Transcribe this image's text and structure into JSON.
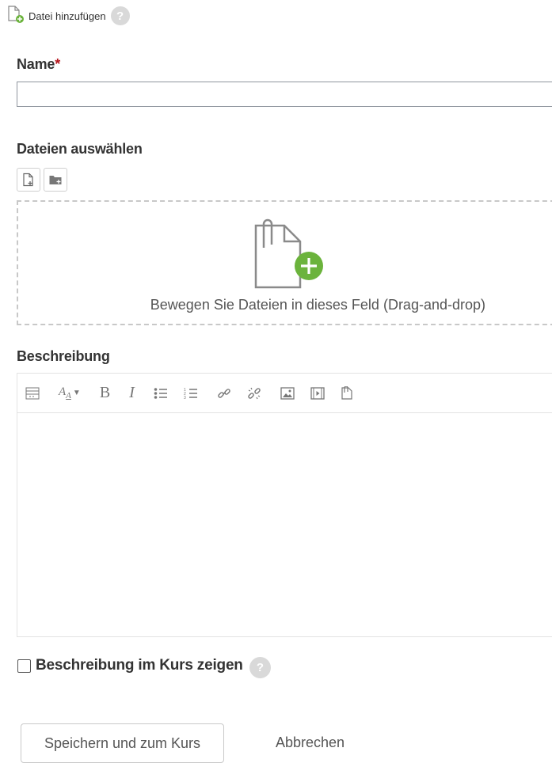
{
  "header": {
    "title": "Datei hinzufügen",
    "help_icon": "?"
  },
  "name_field": {
    "label": "Name",
    "required_mark": "*",
    "value": ""
  },
  "files": {
    "label": "Dateien auswählen",
    "buttons": [
      "add-file-icon",
      "create-folder-icon"
    ],
    "dropzone_text": "Bewegen Sie Dateien in dieses Feld (Drag-and-drop)",
    "accent": "#6bb33c"
  },
  "description": {
    "label": "Beschreibung",
    "toolbar": [
      "collapse-icon",
      "font-style-icon",
      "bold-icon",
      "italic-icon",
      "unordered-list-icon",
      "ordered-list-icon",
      "link-icon",
      "unlink-icon",
      "image-icon",
      "media-icon",
      "manage-files-icon"
    ]
  },
  "show_description": {
    "label": "Beschreibung im Kurs zeigen",
    "help_icon": "?",
    "checked": false
  },
  "actions": {
    "save": "Speichern und zum Kurs",
    "cancel": "Abbrechen"
  }
}
